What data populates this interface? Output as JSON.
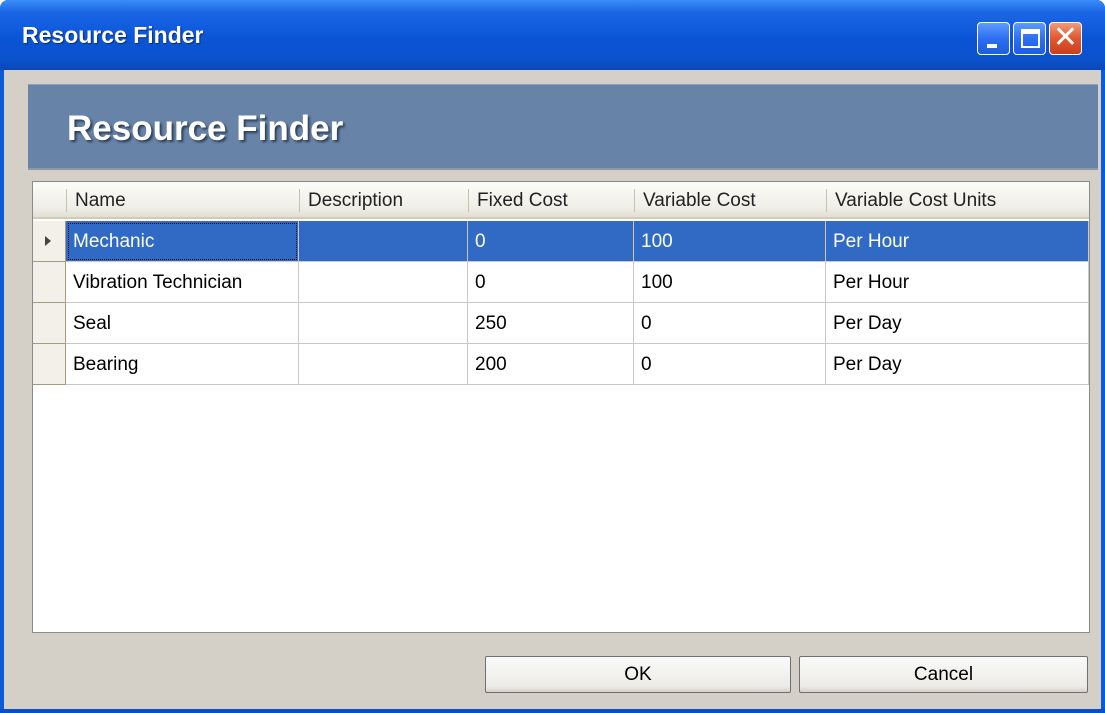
{
  "window": {
    "title": "Resource Finder",
    "controls": {
      "minimize": "minimize-icon",
      "maximize": "maximize-icon",
      "close": "close-icon"
    }
  },
  "banner": {
    "title": "Resource Finder"
  },
  "grid": {
    "columns": [
      "Name",
      "Description",
      "Fixed Cost",
      "Variable Cost",
      "Variable Cost Units"
    ],
    "rows": [
      {
        "name": "Mechanic",
        "description": "",
        "fixed_cost": "0",
        "variable_cost": "100",
        "units": "Per Hour",
        "selected": true
      },
      {
        "name": "Vibration Technician",
        "description": "",
        "fixed_cost": "0",
        "variable_cost": "100",
        "units": "Per Hour",
        "selected": false
      },
      {
        "name": "Seal",
        "description": "",
        "fixed_cost": "250",
        "variable_cost": "0",
        "units": "Per Day",
        "selected": false
      },
      {
        "name": "Bearing",
        "description": "",
        "fixed_cost": "200",
        "variable_cost": "0",
        "units": "Per Day",
        "selected": false
      }
    ],
    "selection_color": "#316ac5"
  },
  "buttons": {
    "ok": "OK",
    "cancel": "Cancel"
  },
  "colors": {
    "titlebar": "#0a55d6",
    "banner": "#6883a8",
    "client": "#d4d0c8",
    "close_button": "#e2562e"
  }
}
